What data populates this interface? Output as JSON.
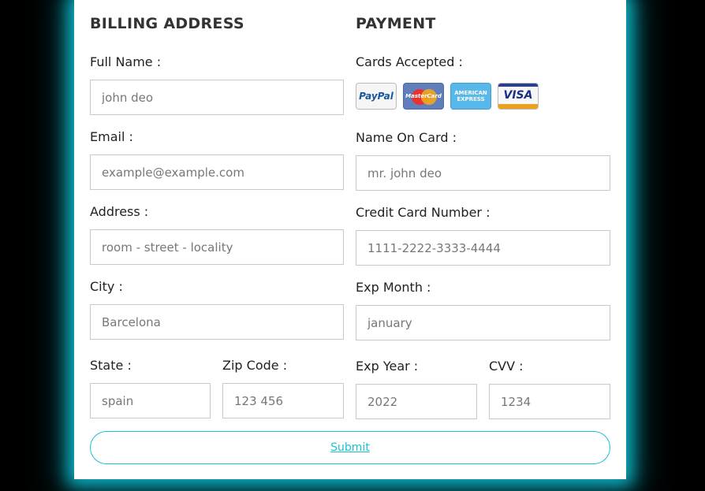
{
  "billing": {
    "heading": "BILLING ADDRESS",
    "full_name": {
      "label": "Full Name :",
      "placeholder": "john deo"
    },
    "email": {
      "label": "Email :",
      "placeholder": "example@example.com"
    },
    "address": {
      "label": "Address :",
      "placeholder": "room - street - locality"
    },
    "city": {
      "label": "City :",
      "placeholder": "Barcelona"
    },
    "state": {
      "label": "State :",
      "placeholder": "spain"
    },
    "zip": {
      "label": "Zip Code :",
      "placeholder": "123 456"
    }
  },
  "payment": {
    "heading": "PAYMENT",
    "cards_label": "Cards Accepted :",
    "cards": {
      "paypal": "PayPal",
      "master": "MasterCard",
      "amex": "AMERICAN EXPRESS",
      "visa": "VISA"
    },
    "name_on_card": {
      "label": "Name On Card :",
      "placeholder": "mr. john deo"
    },
    "card_number": {
      "label": "Credit Card Number :",
      "placeholder": "1111-2222-3333-4444"
    },
    "exp_month": {
      "label": "Exp Month :",
      "placeholder": "january"
    },
    "exp_year": {
      "label": "Exp Year :",
      "placeholder": "2022"
    },
    "cvv": {
      "label": "CVV :",
      "placeholder": "1234"
    }
  },
  "submit_label": "Submit",
  "colors": {
    "accent": "#1cc3cf",
    "glow": "#0fb3c6"
  }
}
